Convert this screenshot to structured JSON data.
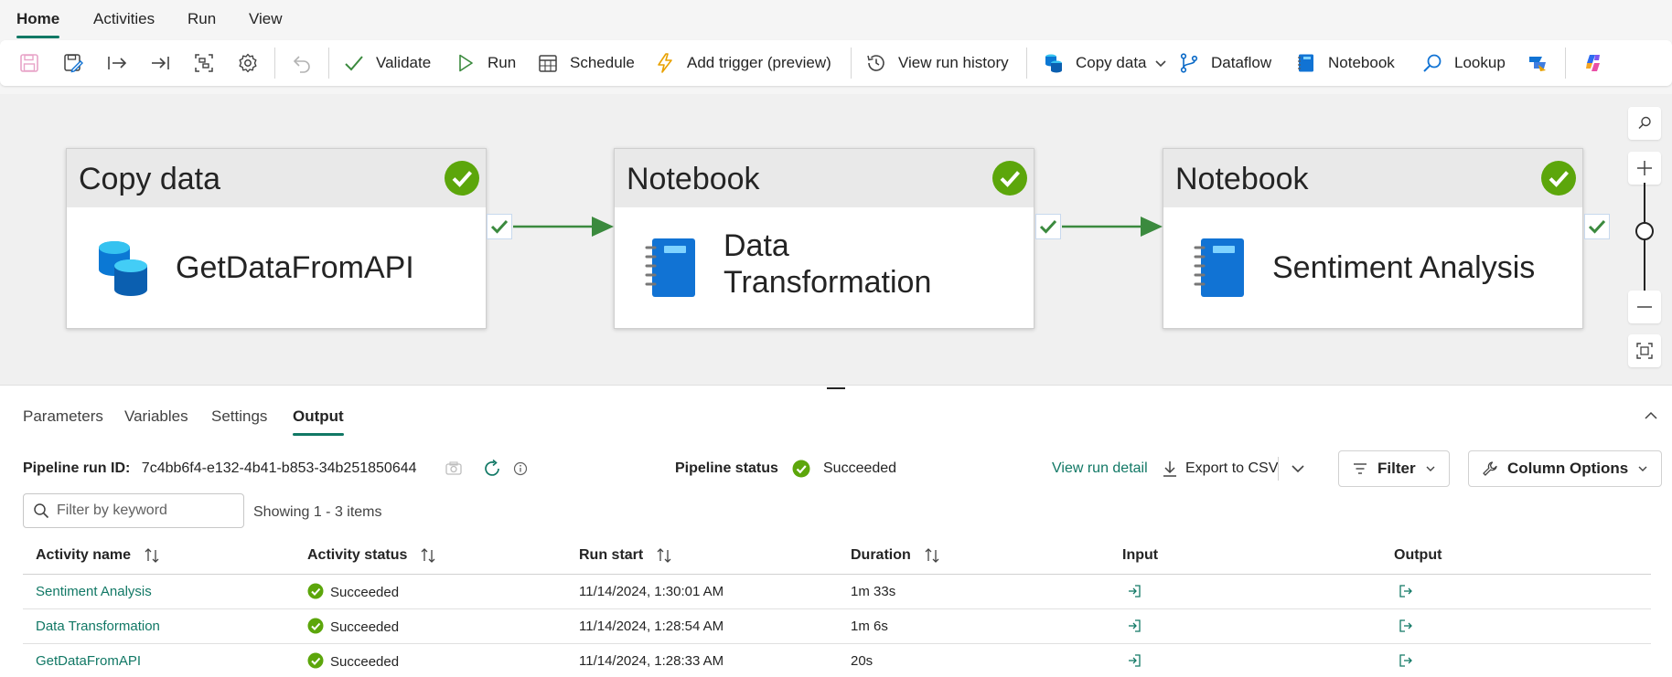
{
  "menu": {
    "tabs": [
      "Home",
      "Activities",
      "Run",
      "View"
    ],
    "active_index": 0
  },
  "ribbon": {
    "validate": "Validate",
    "run": "Run",
    "schedule": "Schedule",
    "add_trigger": "Add trigger (preview)",
    "view_run_history": "View run history",
    "copy_data": "Copy data",
    "dataflow": "Dataflow",
    "notebook": "Notebook",
    "lookup": "Lookup"
  },
  "canvas": {
    "activities": [
      {
        "type": "Copy data",
        "name_lines": [
          "GetDataFromAPI"
        ],
        "icon": "copy-data-icon",
        "status": "succeeded"
      },
      {
        "type": "Notebook",
        "name_lines": [
          "Data",
          "Transformation"
        ],
        "icon": "notebook-icon",
        "status": "succeeded"
      },
      {
        "type": "Notebook",
        "name_lines": [
          "Sentiment Analysis"
        ],
        "icon": "notebook-icon",
        "status": "succeeded"
      }
    ]
  },
  "panel": {
    "tabs": [
      "Parameters",
      "Variables",
      "Settings",
      "Output"
    ],
    "active_index": 3,
    "run_id_label": "Pipeline run ID:",
    "run_id": "7c4bb6f4-e132-4b41-b853-34b251850644",
    "status_label": "Pipeline status",
    "status_value": "Succeeded",
    "view_run_detail": "View run detail",
    "export_csv": "Export to CSV",
    "filter": "Filter",
    "column_options": "Column Options",
    "search_placeholder": "Filter by keyword",
    "showing": "Showing 1 - 3 items",
    "columns": [
      "Activity name",
      "Activity status",
      "Run start",
      "Duration",
      "Input",
      "Output"
    ],
    "rows": [
      {
        "name": "Sentiment Analysis",
        "status": "Succeeded",
        "run_start": "11/14/2024, 1:30:01 AM",
        "duration": "1m 33s"
      },
      {
        "name": "Data Transformation",
        "status": "Succeeded",
        "run_start": "11/14/2024, 1:28:54 AM",
        "duration": "1m 6s"
      },
      {
        "name": "GetDataFromAPI",
        "status": "Succeeded",
        "run_start": "11/14/2024, 1:28:33 AM",
        "duration": "20s"
      }
    ]
  },
  "colors": {
    "accent": "#117865",
    "success": "#5ca60b",
    "connector": "#3b8a3e",
    "notebook_blue": "#1173d4"
  }
}
